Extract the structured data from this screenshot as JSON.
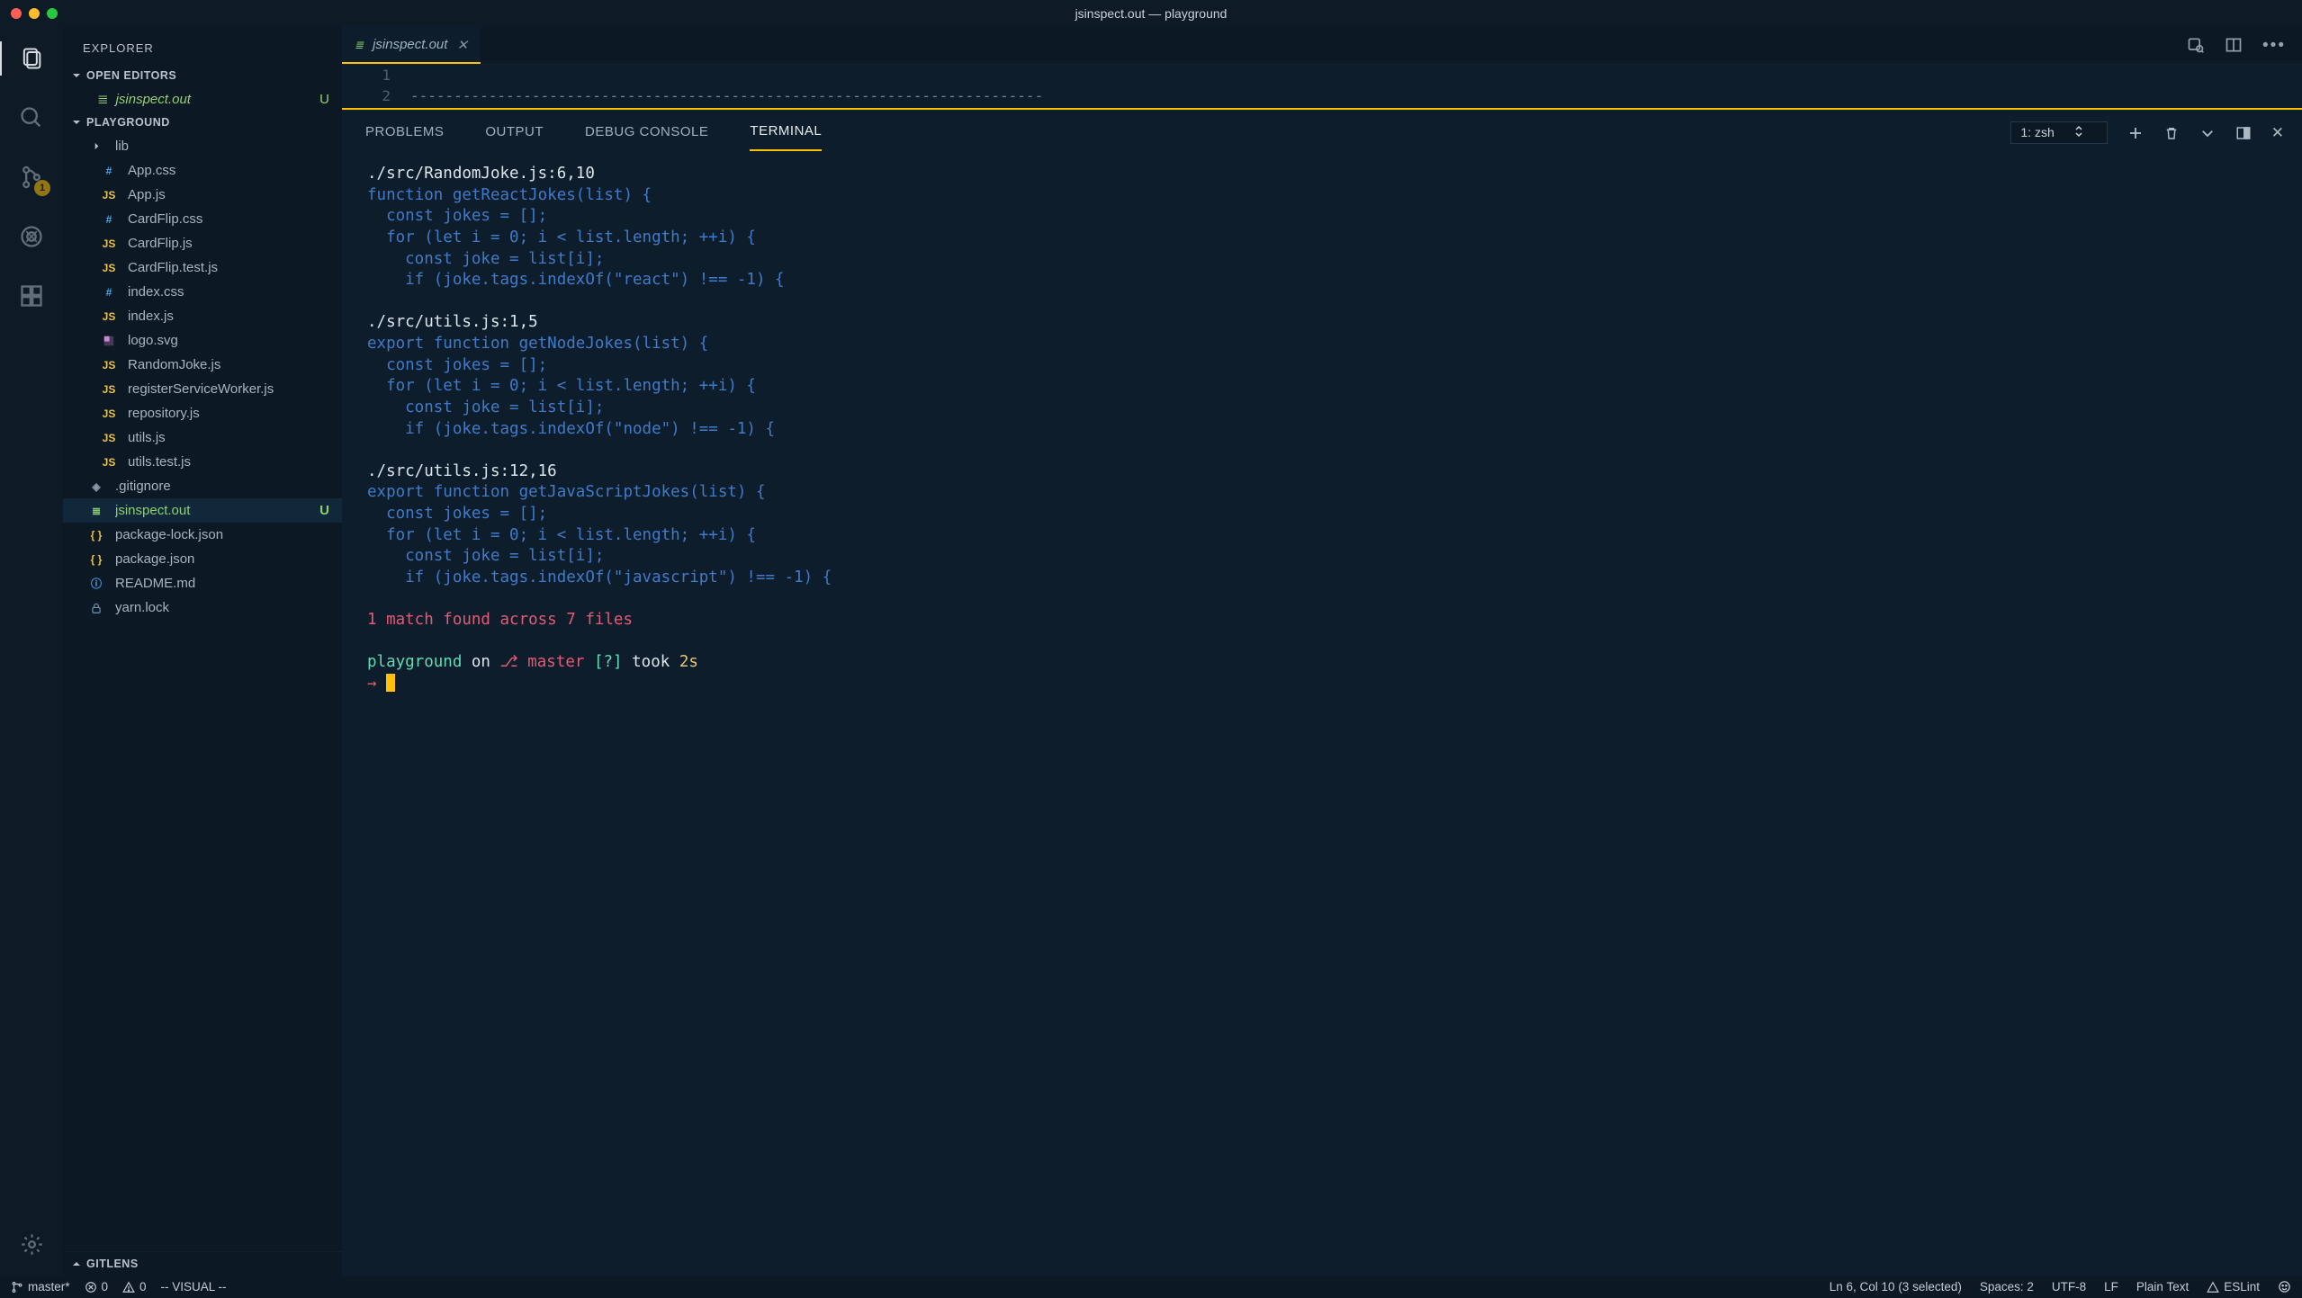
{
  "window_title": "jsinspect.out — playground",
  "activity_badge": "1",
  "sidebar": {
    "title": "EXPLORER",
    "sections": {
      "open_editors": "OPEN EDITORS",
      "workspace": "PLAYGROUND",
      "gitlens": "GITLENS"
    },
    "open_editor": {
      "name": "jsinspect.out",
      "status": "U"
    },
    "folder": "lib",
    "files": [
      {
        "ico": "#",
        "cls": "fi-css",
        "name": "App.css"
      },
      {
        "ico": "JS",
        "cls": "fi-js",
        "name": "App.js"
      },
      {
        "ico": "#",
        "cls": "fi-css",
        "name": "CardFlip.css"
      },
      {
        "ico": "JS",
        "cls": "fi-js",
        "name": "CardFlip.js"
      },
      {
        "ico": "JS",
        "cls": "fi-js",
        "name": "CardFlip.test.js"
      },
      {
        "ico": "#",
        "cls": "fi-css",
        "name": "index.css"
      },
      {
        "ico": "JS",
        "cls": "fi-js",
        "name": "index.js"
      },
      {
        "ico": "",
        "cls": "fi-svg",
        "name": "logo.svg",
        "svg": true
      },
      {
        "ico": "JS",
        "cls": "fi-js",
        "name": "RandomJoke.js"
      },
      {
        "ico": "JS",
        "cls": "fi-js",
        "name": "registerServiceWorker.js"
      },
      {
        "ico": "JS",
        "cls": "fi-js",
        "name": "repository.js"
      },
      {
        "ico": "JS",
        "cls": "fi-js",
        "name": "utils.js"
      },
      {
        "ico": "JS",
        "cls": "fi-js",
        "name": "utils.test.js"
      }
    ],
    "root_files": [
      {
        "ico": "◈",
        "cls": "fi-git",
        "name": ".gitignore"
      },
      {
        "ico": "≣",
        "cls": "fi-out",
        "name": "jsinspect.out",
        "status": "U",
        "active": true
      },
      {
        "ico": "{ }",
        "cls": "fi-json",
        "name": "package-lock.json"
      },
      {
        "ico": "{ }",
        "cls": "fi-json",
        "name": "package.json"
      },
      {
        "ico": "ⓘ",
        "cls": "fi-md",
        "name": "README.md"
      },
      {
        "ico": "",
        "cls": "fi-lock",
        "name": "yarn.lock",
        "lock": true
      }
    ]
  },
  "tab": {
    "icon": "≣",
    "name": "jsinspect.out"
  },
  "editor_lines": [
    "1",
    "2"
  ],
  "editor_dashes": "-------------------------------------------------------------------------",
  "panel_tabs": {
    "problems": "PROBLEMS",
    "output": "OUTPUT",
    "debug": "DEBUG CONSOLE",
    "terminal": "TERMINAL"
  },
  "terminal_select": "1: zsh",
  "terminal": {
    "h1": "./src/RandomJoke.js:6,10",
    "b1": "function getReactJokes(list) {\n  const jokes = [];\n  for (let i = 0; i < list.length; ++i) {\n    const joke = list[i];\n    if (joke.tags.indexOf(\"react\") !== -1) {",
    "h2": "./src/utils.js:1,5",
    "b2": "export function getNodeJokes(list) {\n  const jokes = [];\n  for (let i = 0; i < list.length; ++i) {\n    const joke = list[i];\n    if (joke.tags.indexOf(\"node\") !== -1) {",
    "h3": "./src/utils.js:12,16",
    "b3": "export function getJavaScriptJokes(list) {\n  const jokes = [];\n  for (let i = 0; i < list.length; ++i) {\n    const joke = list[i];\n    if (joke.tags.indexOf(\"javascript\") !== -1) {",
    "summary": "1 match found across 7 files",
    "prompt_dir": "playground",
    "prompt_on": " on ",
    "prompt_branch_sym": "⎇",
    "prompt_branch": " master ",
    "prompt_flags": "[?]",
    "prompt_took": " took ",
    "prompt_time": "2s",
    "arrow": "→ "
  },
  "status": {
    "branch": "master*",
    "errors": "0",
    "warnings": "0",
    "mode": "-- VISUAL --",
    "pos": "Ln 6, Col 10 (3 selected)",
    "spaces": "Spaces: 2",
    "enc": "UTF-8",
    "eol": "LF",
    "lang": "Plain Text",
    "lint": "ESLint"
  }
}
